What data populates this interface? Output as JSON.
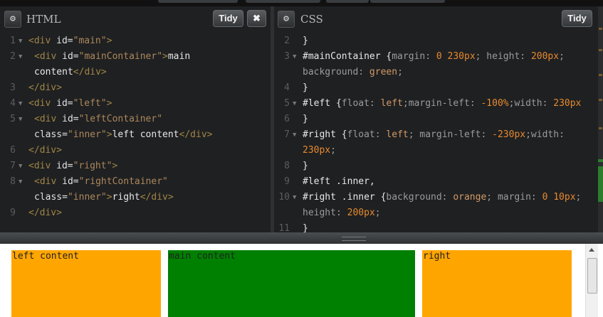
{
  "html_panel": {
    "title": "HTML",
    "tidy_label": "Tidy",
    "close_label": "✖",
    "settings_icon": "gear-icon"
  },
  "css_panel": {
    "title": "CSS",
    "tidy_label": "Tidy",
    "settings_icon": "gear-icon"
  },
  "html_lines": [
    {
      "n": "1",
      "fold": true,
      "seg": [
        [
          "t-tag",
          "<div "
        ],
        [
          "t-attr",
          "id="
        ],
        [
          "t-str",
          "\"main\""
        ],
        [
          "t-tag",
          ">"
        ]
      ]
    },
    {
      "n": "2",
      "fold": true,
      "seg": [
        [
          "t-tag",
          "<div "
        ],
        [
          "t-attr",
          "id="
        ],
        [
          "t-str",
          "\"mainContainer\""
        ],
        [
          "t-tag",
          ">"
        ],
        [
          "t-plain",
          "main"
        ]
      ]
    },
    {
      "n": "",
      "fold": false,
      "seg": [
        [
          "t-plain",
          "content"
        ],
        [
          "t-tag",
          "</div>"
        ]
      ]
    },
    {
      "n": "3",
      "fold": false,
      "seg": [
        [
          "t-tag",
          "</div>"
        ]
      ]
    },
    {
      "n": "4",
      "fold": true,
      "seg": [
        [
          "t-tag",
          "<div "
        ],
        [
          "t-attr",
          "id="
        ],
        [
          "t-str",
          "\"left\""
        ],
        [
          "t-tag",
          ">"
        ]
      ]
    },
    {
      "n": "5",
      "fold": true,
      "seg": [
        [
          "t-tag",
          "<div "
        ],
        [
          "t-attr",
          "id="
        ],
        [
          "t-str",
          "\"leftContainer\""
        ]
      ]
    },
    {
      "n": "",
      "fold": false,
      "seg": [
        [
          "t-attr",
          "class="
        ],
        [
          "t-str",
          "\"inner\""
        ],
        [
          "t-tag",
          ">"
        ],
        [
          "t-plain",
          "left content"
        ],
        [
          "t-tag",
          "</div>"
        ]
      ]
    },
    {
      "n": "6",
      "fold": false,
      "seg": [
        [
          "t-tag",
          "</div>"
        ]
      ]
    },
    {
      "n": "7",
      "fold": true,
      "seg": [
        [
          "t-tag",
          "<div "
        ],
        [
          "t-attr",
          "id="
        ],
        [
          "t-str",
          "\"right\""
        ],
        [
          "t-tag",
          ">"
        ]
      ]
    },
    {
      "n": "8",
      "fold": true,
      "seg": [
        [
          "t-tag",
          "<div "
        ],
        [
          "t-attr",
          "id="
        ],
        [
          "t-str",
          "\"rightContainer\""
        ]
      ]
    },
    {
      "n": "",
      "fold": false,
      "seg": [
        [
          "t-attr",
          "class="
        ],
        [
          "t-str",
          "\"inner\""
        ],
        [
          "t-tag",
          ">"
        ],
        [
          "t-plain",
          "right"
        ],
        [
          "t-tag",
          "</div>"
        ]
      ]
    },
    {
      "n": "9",
      "fold": false,
      "seg": [
        [
          "t-tag",
          "</div>"
        ]
      ]
    }
  ],
  "css_lines": [
    {
      "n": "2",
      "fold": false,
      "seg": [
        [
          "t-brace",
          "}"
        ]
      ]
    },
    {
      "n": "3",
      "fold": true,
      "seg": [
        [
          "t-sel",
          "#mainContainer "
        ],
        [
          "t-brace",
          "{"
        ],
        [
          "t-prop",
          "margin: "
        ],
        [
          "t-num",
          "0 230px"
        ],
        [
          "t-prop",
          "; height: "
        ],
        [
          "t-num",
          "200px"
        ],
        [
          "t-prop",
          ";"
        ]
      ]
    },
    {
      "n": "",
      "fold": false,
      "seg": [
        [
          "t-prop",
          "background: "
        ],
        [
          "t-val",
          "green"
        ],
        [
          "t-prop",
          ";"
        ]
      ]
    },
    {
      "n": "4",
      "fold": false,
      "seg": [
        [
          "t-brace",
          "}"
        ]
      ]
    },
    {
      "n": "5",
      "fold": true,
      "seg": [
        [
          "t-sel",
          "#left "
        ],
        [
          "t-brace",
          "{"
        ],
        [
          "t-prop",
          "float: "
        ],
        [
          "t-val",
          "left"
        ],
        [
          "t-prop",
          ";margin-left: "
        ],
        [
          "t-num",
          "-100%"
        ],
        [
          "t-prop",
          ";width: "
        ],
        [
          "t-num",
          "230px"
        ]
      ]
    },
    {
      "n": "6",
      "fold": false,
      "seg": [
        [
          "t-brace",
          "}"
        ]
      ]
    },
    {
      "n": "7",
      "fold": true,
      "seg": [
        [
          "t-sel",
          "#right "
        ],
        [
          "t-brace",
          "{"
        ],
        [
          "t-prop",
          "float: "
        ],
        [
          "t-val",
          "left"
        ],
        [
          "t-prop",
          "; margin-left: "
        ],
        [
          "t-num",
          "-230px"
        ],
        [
          "t-prop",
          ";width:"
        ]
      ]
    },
    {
      "n": "",
      "fold": false,
      "seg": [
        [
          "t-num",
          "230px"
        ],
        [
          "t-prop",
          ";"
        ]
      ]
    },
    {
      "n": "8",
      "fold": false,
      "seg": [
        [
          "t-brace",
          "}"
        ]
      ]
    },
    {
      "n": "9",
      "fold": false,
      "seg": [
        [
          "t-sel",
          "#left .inner,"
        ]
      ]
    },
    {
      "n": "10",
      "fold": true,
      "seg": [
        [
          "t-sel",
          "#right .inner "
        ],
        [
          "t-brace",
          "{"
        ],
        [
          "t-prop",
          "background: "
        ],
        [
          "t-val",
          "orange"
        ],
        [
          "t-prop",
          "; margin: "
        ],
        [
          "t-num",
          "0 10px"
        ],
        [
          "t-prop",
          ";"
        ]
      ]
    },
    {
      "n": "",
      "fold": false,
      "seg": [
        [
          "t-prop",
          "height: "
        ],
        [
          "t-num",
          "200px"
        ],
        [
          "t-prop",
          ";"
        ]
      ]
    },
    {
      "n": "11",
      "fold": false,
      "seg": [
        [
          "t-brace",
          "}"
        ]
      ]
    }
  ],
  "result": {
    "left_label": "left content",
    "main_label": "main content",
    "right_label": "right",
    "left_color": "#ffa500",
    "main_color": "#008000",
    "right_color": "#ffa500"
  }
}
